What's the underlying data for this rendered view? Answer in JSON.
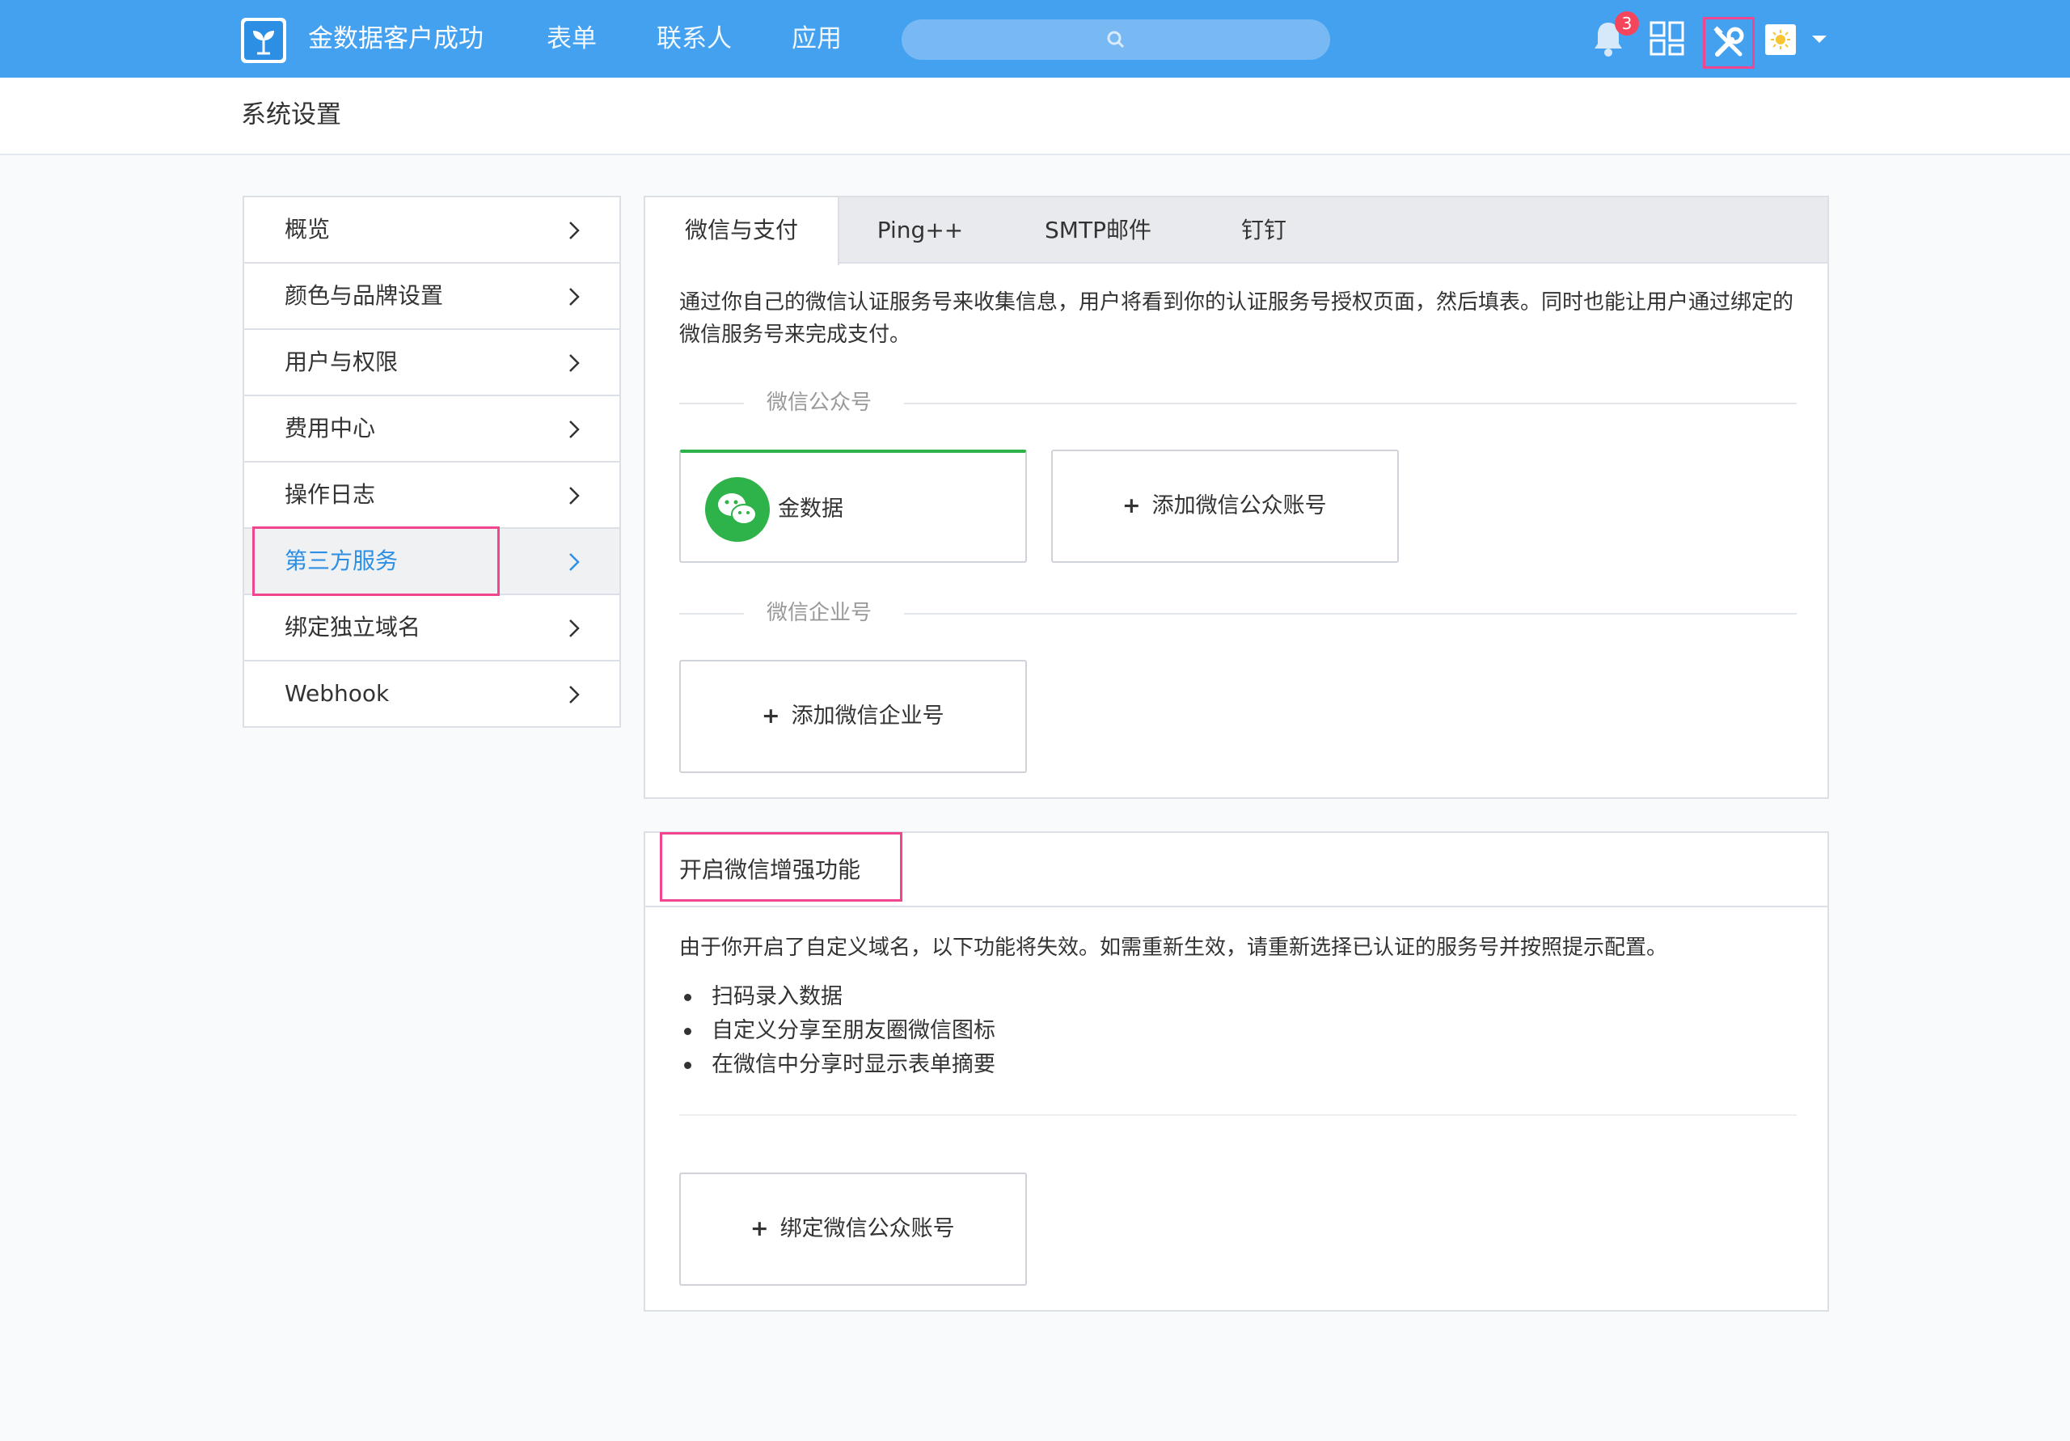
{
  "topbar": {
    "brand": "金数据客户成功",
    "nav": [
      "表单",
      "联系人",
      "应用"
    ],
    "notification_count": "3",
    "accent_color": "#44a1f0"
  },
  "page": {
    "title": "系统设置"
  },
  "sidebar": {
    "items": [
      {
        "label": "概览"
      },
      {
        "label": "颜色与品牌设置"
      },
      {
        "label": "用户与权限"
      },
      {
        "label": "费用中心"
      },
      {
        "label": "操作日志"
      },
      {
        "label": "第三方服务",
        "active": true
      },
      {
        "label": "绑定独立域名"
      },
      {
        "label": "Webhook"
      }
    ]
  },
  "third_party": {
    "tabs": [
      "微信与支付",
      "Ping++",
      "SMTP邮件",
      "钉钉"
    ],
    "active_tab": "微信与支付",
    "description": "通过你自己的微信认证服务号来收集信息，用户将看到你的认证服务号授权页面，然后填表。同时也能让用户通过绑定的微信服务号来完成支付。",
    "official_account_section": "微信公众号",
    "official_account_name": "金数据",
    "add_official_account": "添加微信公众账号",
    "enterprise_section": "微信企业号",
    "add_enterprise": "添加微信企业号"
  },
  "enhance": {
    "title": "开启微信增强功能",
    "description": "由于你开启了自定义域名，以下功能将失效。如需重新生效，请重新选择已认证的服务号并按照提示配置。",
    "features": [
      "扫码录入数据",
      "自定义分享至朋友圈微信图标",
      "在微信中分享时显示表单摘要"
    ],
    "bind_button": "绑定微信公众账号"
  },
  "icons": [
    "logo-icon",
    "search-icon",
    "bell-icon",
    "apps-grid-icon",
    "tools-icon",
    "avatar",
    "chevron-right-icon",
    "wechat-icon",
    "plus-icon"
  ]
}
